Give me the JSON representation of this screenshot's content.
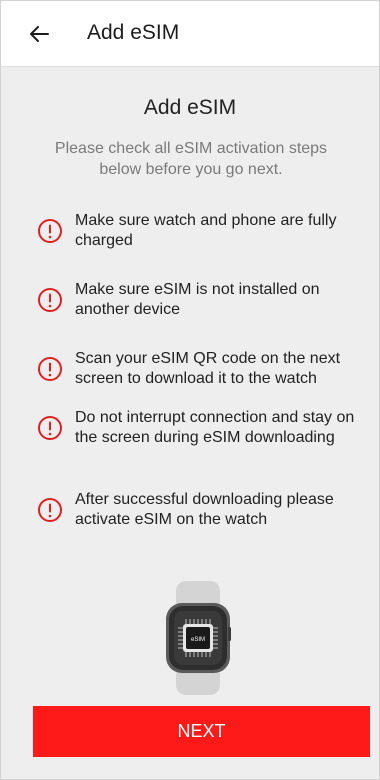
{
  "appbar": {
    "title": "Add eSIM",
    "back_icon": "arrow-left-icon"
  },
  "main": {
    "title": "Add eSIM",
    "subtitle": "Please check all eSIM activation steps below before you go next."
  },
  "steps": [
    {
      "icon": "exclamation-circle-icon",
      "text": "Make sure watch and phone are fully charged"
    },
    {
      "icon": "exclamation-circle-icon",
      "text": "Make sure eSIM is not installed on another device"
    },
    {
      "icon": "exclamation-circle-icon",
      "text": "Scan your eSIM QR code on the next screen to download it to the watch"
    },
    {
      "icon": "exclamation-circle-icon",
      "text": "Do not interrupt connection and stay on the screen during eSIM downloading"
    },
    {
      "icon": "exclamation-circle-icon",
      "text": "After successful downloading please activate eSIM on the watch"
    }
  ],
  "illustration": {
    "chip_label": "eSIM"
  },
  "next_button": {
    "label": "NEXT"
  },
  "colors": {
    "accent": "#ff1a1a",
    "warning": "#e02020",
    "background": "#eeeeee",
    "appbar": "#ffffff"
  }
}
